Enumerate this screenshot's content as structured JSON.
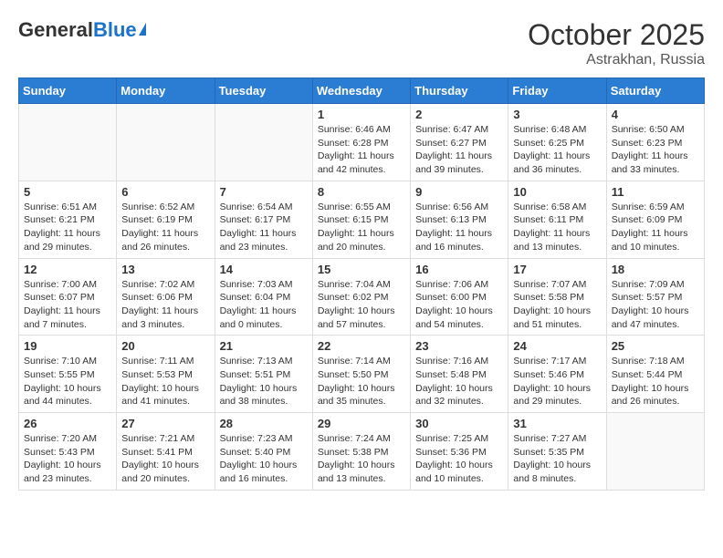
{
  "header": {
    "logo_general": "General",
    "logo_blue": "Blue",
    "month_title": "October 2025",
    "subtitle": "Astrakhan, Russia"
  },
  "days_of_week": [
    "Sunday",
    "Monday",
    "Tuesday",
    "Wednesday",
    "Thursday",
    "Friday",
    "Saturday"
  ],
  "weeks": [
    [
      {
        "day": "",
        "info": ""
      },
      {
        "day": "",
        "info": ""
      },
      {
        "day": "",
        "info": ""
      },
      {
        "day": "1",
        "info": "Sunrise: 6:46 AM\nSunset: 6:28 PM\nDaylight: 11 hours\nand 42 minutes."
      },
      {
        "day": "2",
        "info": "Sunrise: 6:47 AM\nSunset: 6:27 PM\nDaylight: 11 hours\nand 39 minutes."
      },
      {
        "day": "3",
        "info": "Sunrise: 6:48 AM\nSunset: 6:25 PM\nDaylight: 11 hours\nand 36 minutes."
      },
      {
        "day": "4",
        "info": "Sunrise: 6:50 AM\nSunset: 6:23 PM\nDaylight: 11 hours\nand 33 minutes."
      }
    ],
    [
      {
        "day": "5",
        "info": "Sunrise: 6:51 AM\nSunset: 6:21 PM\nDaylight: 11 hours\nand 29 minutes."
      },
      {
        "day": "6",
        "info": "Sunrise: 6:52 AM\nSunset: 6:19 PM\nDaylight: 11 hours\nand 26 minutes."
      },
      {
        "day": "7",
        "info": "Sunrise: 6:54 AM\nSunset: 6:17 PM\nDaylight: 11 hours\nand 23 minutes."
      },
      {
        "day": "8",
        "info": "Sunrise: 6:55 AM\nSunset: 6:15 PM\nDaylight: 11 hours\nand 20 minutes."
      },
      {
        "day": "9",
        "info": "Sunrise: 6:56 AM\nSunset: 6:13 PM\nDaylight: 11 hours\nand 16 minutes."
      },
      {
        "day": "10",
        "info": "Sunrise: 6:58 AM\nSunset: 6:11 PM\nDaylight: 11 hours\nand 13 minutes."
      },
      {
        "day": "11",
        "info": "Sunrise: 6:59 AM\nSunset: 6:09 PM\nDaylight: 11 hours\nand 10 minutes."
      }
    ],
    [
      {
        "day": "12",
        "info": "Sunrise: 7:00 AM\nSunset: 6:07 PM\nDaylight: 11 hours\nand 7 minutes."
      },
      {
        "day": "13",
        "info": "Sunrise: 7:02 AM\nSunset: 6:06 PM\nDaylight: 11 hours\nand 3 minutes."
      },
      {
        "day": "14",
        "info": "Sunrise: 7:03 AM\nSunset: 6:04 PM\nDaylight: 11 hours\nand 0 minutes."
      },
      {
        "day": "15",
        "info": "Sunrise: 7:04 AM\nSunset: 6:02 PM\nDaylight: 10 hours\nand 57 minutes."
      },
      {
        "day": "16",
        "info": "Sunrise: 7:06 AM\nSunset: 6:00 PM\nDaylight: 10 hours\nand 54 minutes."
      },
      {
        "day": "17",
        "info": "Sunrise: 7:07 AM\nSunset: 5:58 PM\nDaylight: 10 hours\nand 51 minutes."
      },
      {
        "day": "18",
        "info": "Sunrise: 7:09 AM\nSunset: 5:57 PM\nDaylight: 10 hours\nand 47 minutes."
      }
    ],
    [
      {
        "day": "19",
        "info": "Sunrise: 7:10 AM\nSunset: 5:55 PM\nDaylight: 10 hours\nand 44 minutes."
      },
      {
        "day": "20",
        "info": "Sunrise: 7:11 AM\nSunset: 5:53 PM\nDaylight: 10 hours\nand 41 minutes."
      },
      {
        "day": "21",
        "info": "Sunrise: 7:13 AM\nSunset: 5:51 PM\nDaylight: 10 hours\nand 38 minutes."
      },
      {
        "day": "22",
        "info": "Sunrise: 7:14 AM\nSunset: 5:50 PM\nDaylight: 10 hours\nand 35 minutes."
      },
      {
        "day": "23",
        "info": "Sunrise: 7:16 AM\nSunset: 5:48 PM\nDaylight: 10 hours\nand 32 minutes."
      },
      {
        "day": "24",
        "info": "Sunrise: 7:17 AM\nSunset: 5:46 PM\nDaylight: 10 hours\nand 29 minutes."
      },
      {
        "day": "25",
        "info": "Sunrise: 7:18 AM\nSunset: 5:44 PM\nDaylight: 10 hours\nand 26 minutes."
      }
    ],
    [
      {
        "day": "26",
        "info": "Sunrise: 7:20 AM\nSunset: 5:43 PM\nDaylight: 10 hours\nand 23 minutes."
      },
      {
        "day": "27",
        "info": "Sunrise: 7:21 AM\nSunset: 5:41 PM\nDaylight: 10 hours\nand 20 minutes."
      },
      {
        "day": "28",
        "info": "Sunrise: 7:23 AM\nSunset: 5:40 PM\nDaylight: 10 hours\nand 16 minutes."
      },
      {
        "day": "29",
        "info": "Sunrise: 7:24 AM\nSunset: 5:38 PM\nDaylight: 10 hours\nand 13 minutes."
      },
      {
        "day": "30",
        "info": "Sunrise: 7:25 AM\nSunset: 5:36 PM\nDaylight: 10 hours\nand 10 minutes."
      },
      {
        "day": "31",
        "info": "Sunrise: 7:27 AM\nSunset: 5:35 PM\nDaylight: 10 hours\nand 8 minutes."
      },
      {
        "day": "",
        "info": ""
      }
    ]
  ]
}
